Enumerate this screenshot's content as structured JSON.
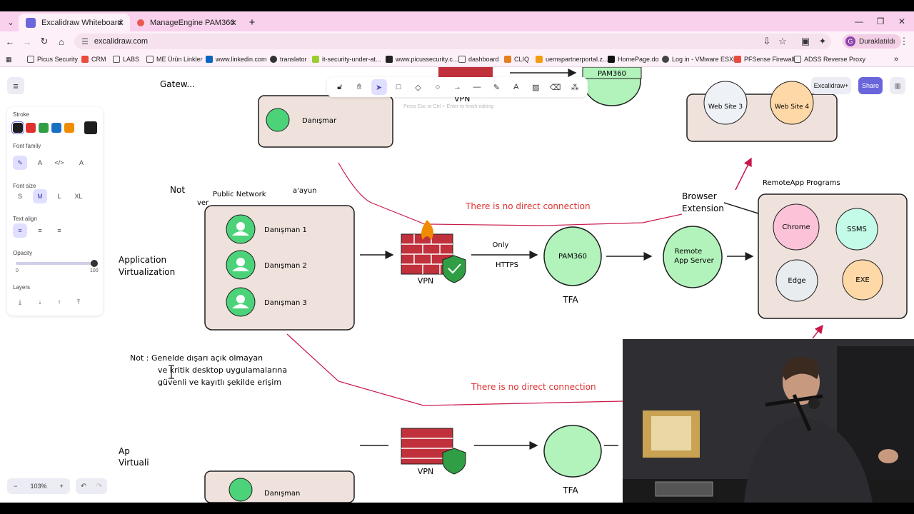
{
  "browser": {
    "tabs": [
      {
        "title": "Excalidraw Whiteboard",
        "active": true
      },
      {
        "title": "ManageEngine PAM360",
        "active": false
      }
    ],
    "url": "excalidraw.com",
    "profile_initial": "G",
    "profile_name": "Duraklatıldı",
    "bookmarks": [
      "Picus Security",
      "CRM",
      "LABS",
      "ME Ürün Linkler",
      "www.linkedin.com",
      "translator",
      "it-security-under-at...",
      "www.picussecurity.c...",
      "dashboard",
      "CLIQ",
      "uemspartnerportal.z...",
      "HomePage.do",
      "Log in - VMware ESXi",
      "PFSense Firewall",
      "ADSS Reverse Proxy"
    ]
  },
  "excalidraw": {
    "hint": "Press Esc or Ctrl + Enter to finish editing",
    "top_right": {
      "plus_label": "Excalidraw+",
      "share_label": "Share"
    },
    "properties": {
      "stroke_label": "Stroke",
      "stroke_colors": [
        "#1e1e1e",
        "#e03131",
        "#2f9e44",
        "#1971c2",
        "#f08c00"
      ],
      "current_stroke": "#1e1e1e",
      "font_family_label": "Font family",
      "font_size_label": "Font size",
      "font_sizes": [
        "S",
        "M",
        "L",
        "XL"
      ],
      "text_align_label": "Text align",
      "opacity_label": "Opacity",
      "opacity_min": "0",
      "opacity_max": "100",
      "layers_label": "Layers"
    },
    "zoom": "103%"
  },
  "diagram": {
    "top_left_fragment": "Gatew...",
    "top_partial_labels": {
      "pam360": "PAM360",
      "vpn": "VPN",
      "danisman": "Danışmar",
      "web_site_3": "Web Site 3",
      "web_site_4": "Web Site 4"
    },
    "note_fragment_1": "Not",
    "note_fragment_2": "ver",
    "note_fragment_3": "a'ayun",
    "public_network": "Public Network",
    "app_virtualization": "Application Virtualization",
    "consultants": [
      "Danışman 1",
      "Danışman 2",
      "Danışman 3"
    ],
    "vpn_label": "VPN",
    "only_label": "Only",
    "https_label": "HTTPS",
    "pam360_label": "PAM360",
    "tfa_label": "TFA",
    "remote_app_server": "Remote App Server",
    "browser_extension": "Browser Extension",
    "remoteapp_programs": "RemoteApp Programs",
    "programs": [
      "Chrome",
      "SSMS",
      "Edge",
      "EXE"
    ],
    "no_direct_top": "There is no direct connection",
    "no_direct_bottom": "There is no direct connection",
    "note_bottom_line1": "Not : Genelde dışarı açık olmayan",
    "note_bottom_line2": "ve kritik desktop uygulamalarına",
    "note_bottom_line3": "güvenli ve kayıtlı şekilde erişim",
    "bottom_app_virtualization": "Application Virtualization",
    "bottom_vpn": "VPN",
    "bottom_tfa": "TFA",
    "bottom_danisman": "Danışman"
  }
}
